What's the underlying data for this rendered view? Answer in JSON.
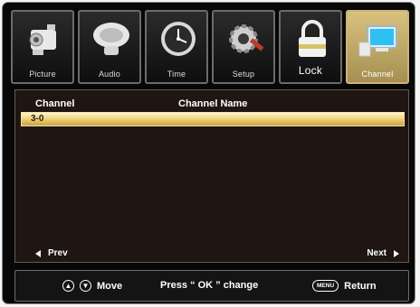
{
  "tabs": [
    {
      "label": "Picture",
      "icon": "camcorder-icon"
    },
    {
      "label": "Audio",
      "icon": "speaker-icon"
    },
    {
      "label": "Time",
      "icon": "clock-icon"
    },
    {
      "label": "Setup",
      "icon": "gear-wrench-icon"
    },
    {
      "label": "Lock",
      "icon": "padlock-icon"
    },
    {
      "label": "Channel",
      "icon": "monitor-icon"
    }
  ],
  "active_tab": "Channel",
  "table": {
    "headers": {
      "channel": "Channel",
      "name": "Channel Name"
    },
    "rows": [
      {
        "channel": "3-0",
        "name": ""
      }
    ]
  },
  "pager": {
    "prev": "Prev",
    "next": "Next"
  },
  "footer": {
    "move": "Move",
    "press_prefix": "Press “ OK ” change",
    "menu_key": "MENU",
    "return": "Return"
  },
  "colors": {
    "active_tab": "#c9b47a",
    "selection": "#e9c766",
    "panel_bg": "#1f1512"
  }
}
